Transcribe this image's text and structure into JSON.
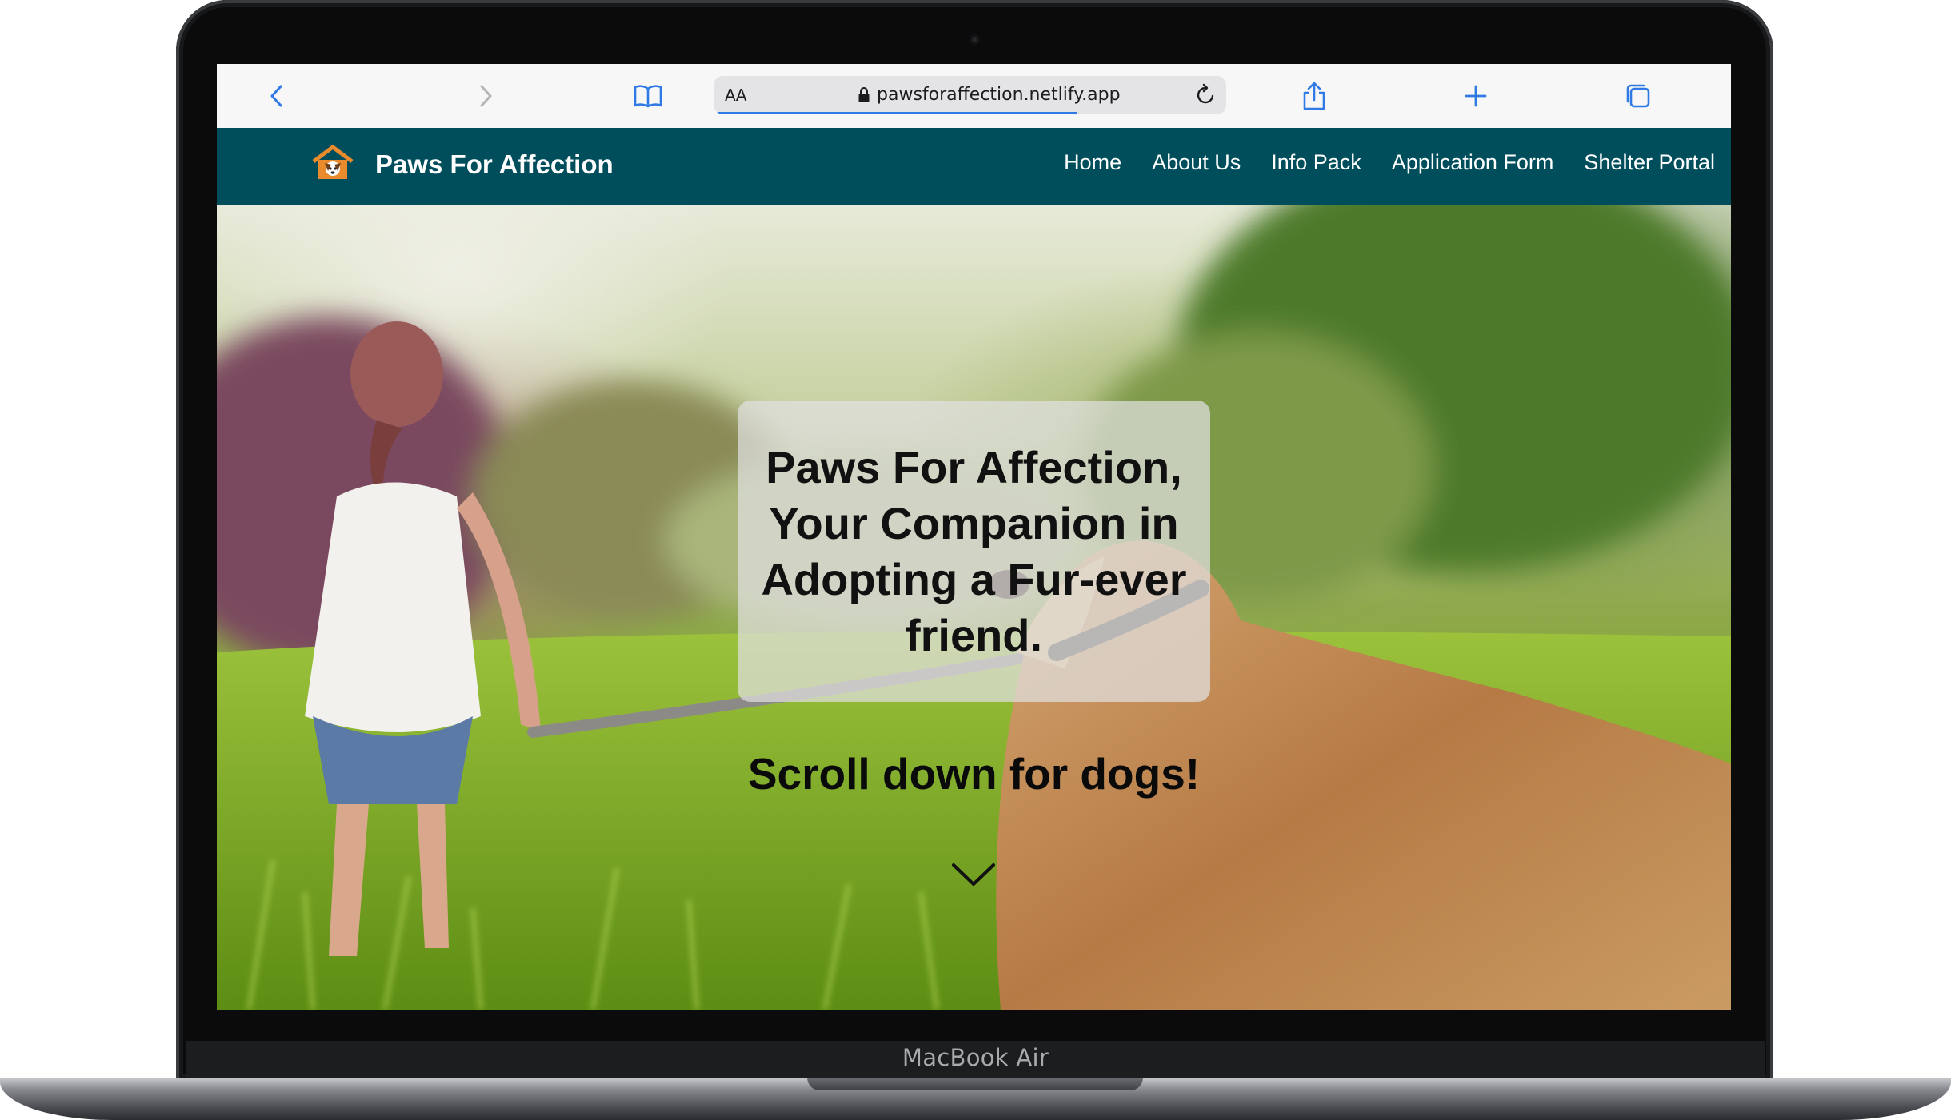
{
  "device": {
    "model_label": "MacBook Air"
  },
  "browser": {
    "address_text_size_label": "AA",
    "url": "pawsforaffection.netlify.app",
    "icons": {
      "back": "chevron-left-icon",
      "forward": "chevron-right-icon",
      "bookmarks": "book-icon",
      "lock": "lock-icon",
      "reload": "reload-icon",
      "share": "share-icon",
      "new_tab": "plus-icon",
      "tabs": "tabs-icon"
    },
    "accent_color": "#2f7ae5"
  },
  "site": {
    "brand": {
      "name": "Paws For Affection",
      "logo_icon": "house-dog-logo-icon"
    },
    "nav": {
      "background_color": "#004e5c",
      "links": [
        {
          "label": "Home"
        },
        {
          "label": "About Us"
        },
        {
          "label": "Info Pack"
        },
        {
          "label": "Application Form"
        },
        {
          "label": "Shelter Portal"
        }
      ]
    },
    "hero": {
      "title": "Paws For Affection, Your Companion in Adopting a Fur-ever friend.",
      "subtitle": "Scroll down for dogs!",
      "scroll_icon": "chevron-down-icon"
    }
  }
}
